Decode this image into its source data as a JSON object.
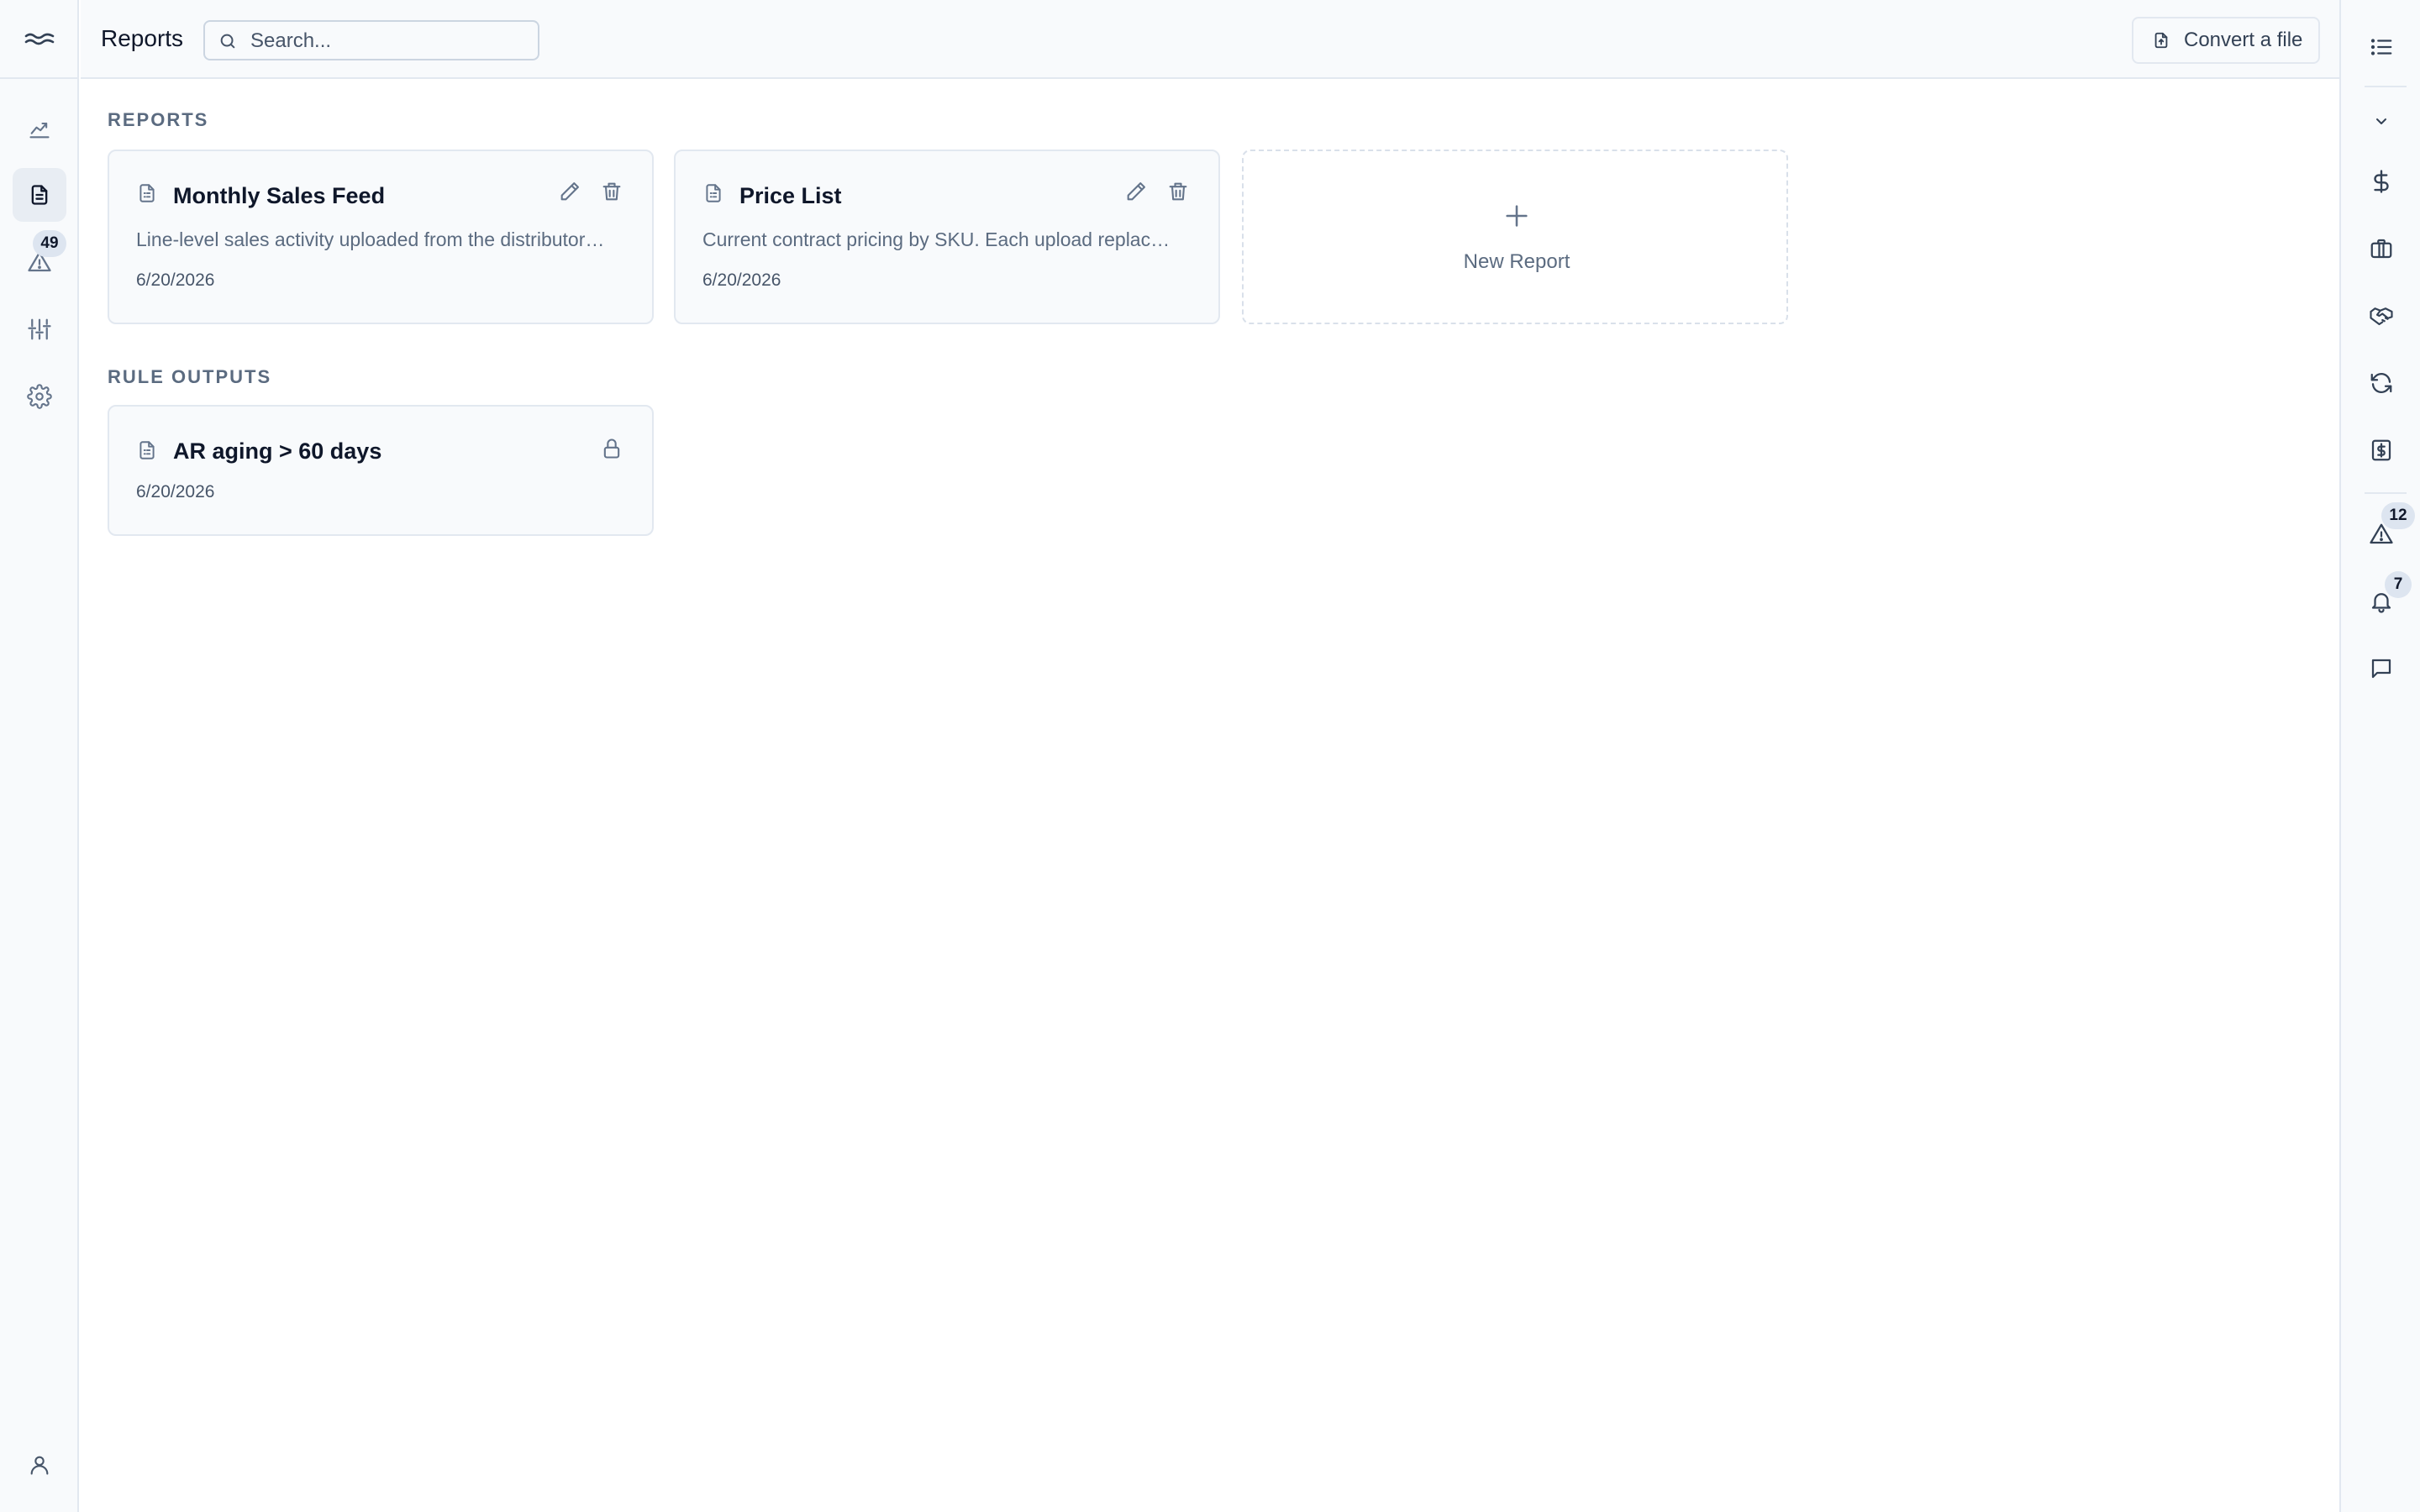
{
  "header": {
    "title": "Reports",
    "search_placeholder": "Search...",
    "convert_label": "Convert a file"
  },
  "left_rail": {
    "items": [
      {
        "name": "analytics",
        "icon": "trend-chart-icon"
      },
      {
        "name": "reports",
        "icon": "document-icon",
        "active": true
      },
      {
        "name": "alerts",
        "icon": "warning-icon",
        "badge": "49"
      },
      {
        "name": "rules",
        "icon": "sliders-icon"
      },
      {
        "name": "settings",
        "icon": "gear-icon"
      }
    ],
    "bottom": {
      "icon": "user-icon"
    }
  },
  "sections": {
    "reports": {
      "title": "REPORTS",
      "cards": [
        {
          "title": "Monthly Sales Feed",
          "description": "Line-level sales activity uploaded from the distributor…",
          "date": "6/20/2026"
        },
        {
          "title": "Price List",
          "description": "Current contract pricing by SKU. Each upload replac…",
          "date": "6/20/2026"
        }
      ],
      "new_label": "New Report"
    },
    "rule_outputs": {
      "title": "RULE OUTPUTS",
      "cards": [
        {
          "title": "AR aging > 60 days",
          "date": "6/20/2026",
          "locked": true
        }
      ]
    }
  },
  "right_rail": {
    "items": [
      {
        "icon": "list-icon"
      },
      {
        "icon": "chevron-down-icon"
      },
      {
        "icon": "dollar-icon"
      },
      {
        "icon": "briefcase-icon"
      },
      {
        "icon": "handshake-icon"
      },
      {
        "icon": "refresh-icon"
      },
      {
        "icon": "dollar-document-icon"
      },
      {
        "icon": "warning-icon",
        "badge": "12"
      },
      {
        "icon": "bell-icon",
        "badge": "7"
      },
      {
        "icon": "chat-icon"
      }
    ]
  },
  "colors": {
    "rail_bg": "#f8fafc",
    "border": "#e2e8f0",
    "badge_bg": "#dde5f0",
    "muted_text": "#5b6b80"
  }
}
